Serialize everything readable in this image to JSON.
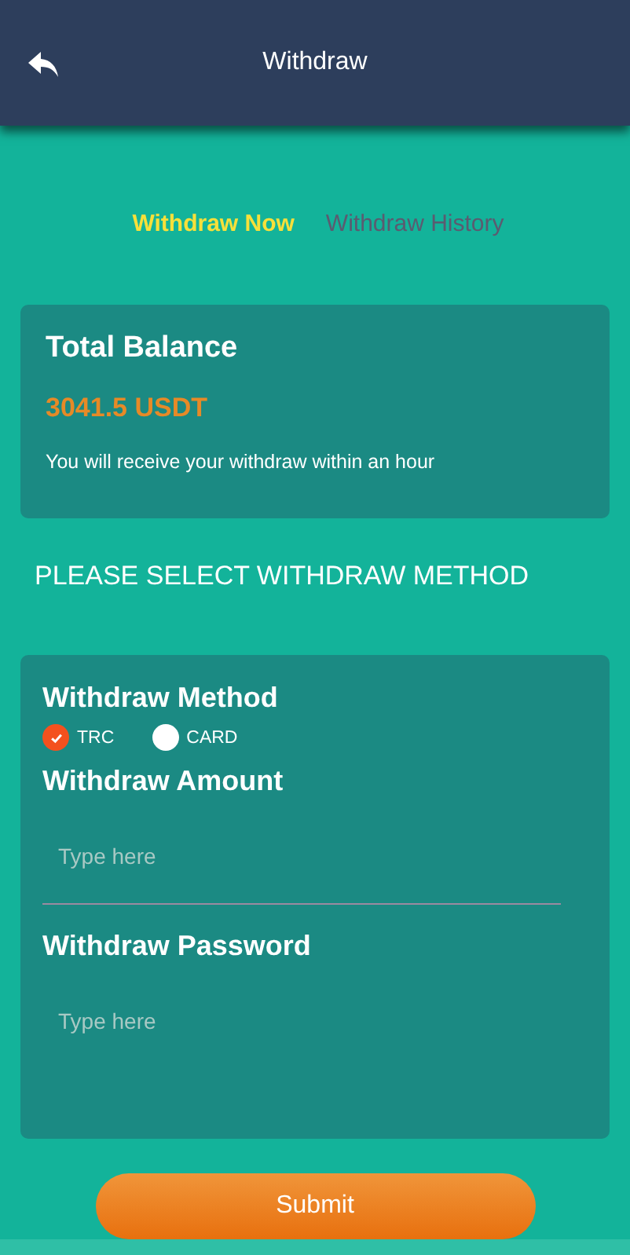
{
  "header": {
    "title": "Withdraw"
  },
  "tabs": [
    {
      "label": "Withdraw Now",
      "selected": true
    },
    {
      "label": "Withdraw History",
      "selected": false
    }
  ],
  "balance": {
    "title": "Total Balance",
    "amount": "3041.5 USDT",
    "note": "You will receive your withdraw within an hour"
  },
  "section_heading": "PLEASE SELECT WITHDRAW METHOD",
  "form": {
    "method_label": "Withdraw Method",
    "methods": [
      {
        "label": "TRC",
        "selected": true
      },
      {
        "label": "CARD",
        "selected": false
      }
    ],
    "amount": {
      "label": "Withdraw Amount",
      "placeholder": "Type here"
    },
    "password": {
      "label": "Withdraw Password",
      "placeholder": "Type here"
    }
  },
  "submit": "Submit"
}
